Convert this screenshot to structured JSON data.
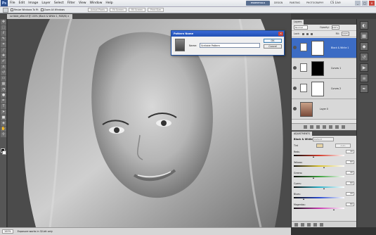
{
  "menubar": {
    "app_badge": "Ps",
    "items": [
      "File",
      "Edit",
      "Image",
      "Layer",
      "Select",
      "Filter",
      "View",
      "Window",
      "Help"
    ],
    "workspace_active": "ESSENTIALS",
    "workspaces": [
      "DESIGN",
      "PAINTING",
      "PHOTOGRAPHY"
    ],
    "cs_live": "CS Live",
    "win_min": "_",
    "win_max": "□",
    "win_close": "×"
  },
  "options": {
    "resize_windows": "Resize Windows To Fit",
    "zoom_all": "Zoom All Windows",
    "actual_pixels": "Actual Pixels",
    "fit_screen": "Fit Screen",
    "fill_screen": "Fill Screen",
    "print_size": "Print Size"
  },
  "document": {
    "tab": "scribble_after.tif @ 100% (Black & White 1, RGB/8) ×"
  },
  "dialog": {
    "title": "Pattern Name",
    "close": "×",
    "name_label": "Name:",
    "name_value": "Scribble Pattern",
    "ok": "OK",
    "cancel": "Cancel"
  },
  "layers": {
    "tab": "Layers",
    "blend_mode": "Normal",
    "opacity_label": "Opacity:",
    "opacity_value": "100%",
    "lock_label": "Lock:",
    "fill_label": "Fill:",
    "fill_value": "100%",
    "items": [
      {
        "name": "Black & White 1"
      },
      {
        "name": "Curves 1"
      },
      {
        "name": "Curves 2"
      },
      {
        "name": "Layer 0"
      }
    ]
  },
  "adjustments": {
    "tab": "ADJUSTMENTS",
    "title": "Black & White",
    "preset": "Default",
    "tint_label": "Tint",
    "auto": "Auto",
    "sliders": [
      {
        "name": "Reds:",
        "value": 40,
        "color": "#d23a2a"
      },
      {
        "name": "Yellows:",
        "value": 60,
        "color": "#d8c02a"
      },
      {
        "name": "Greens:",
        "value": 40,
        "color": "#3aa03a"
      },
      {
        "name": "Cyans:",
        "value": 60,
        "color": "#2ab0c8"
      },
      {
        "name": "Blues:",
        "value": 20,
        "color": "#2a4ad0"
      },
      {
        "name": "Magentas:",
        "value": 80,
        "color": "#c83ab0"
      }
    ]
  },
  "status": {
    "zoom": "100%",
    "info": "Exposure works in 32-bit only"
  },
  "colors": {
    "accent": "#3c6cc4"
  }
}
